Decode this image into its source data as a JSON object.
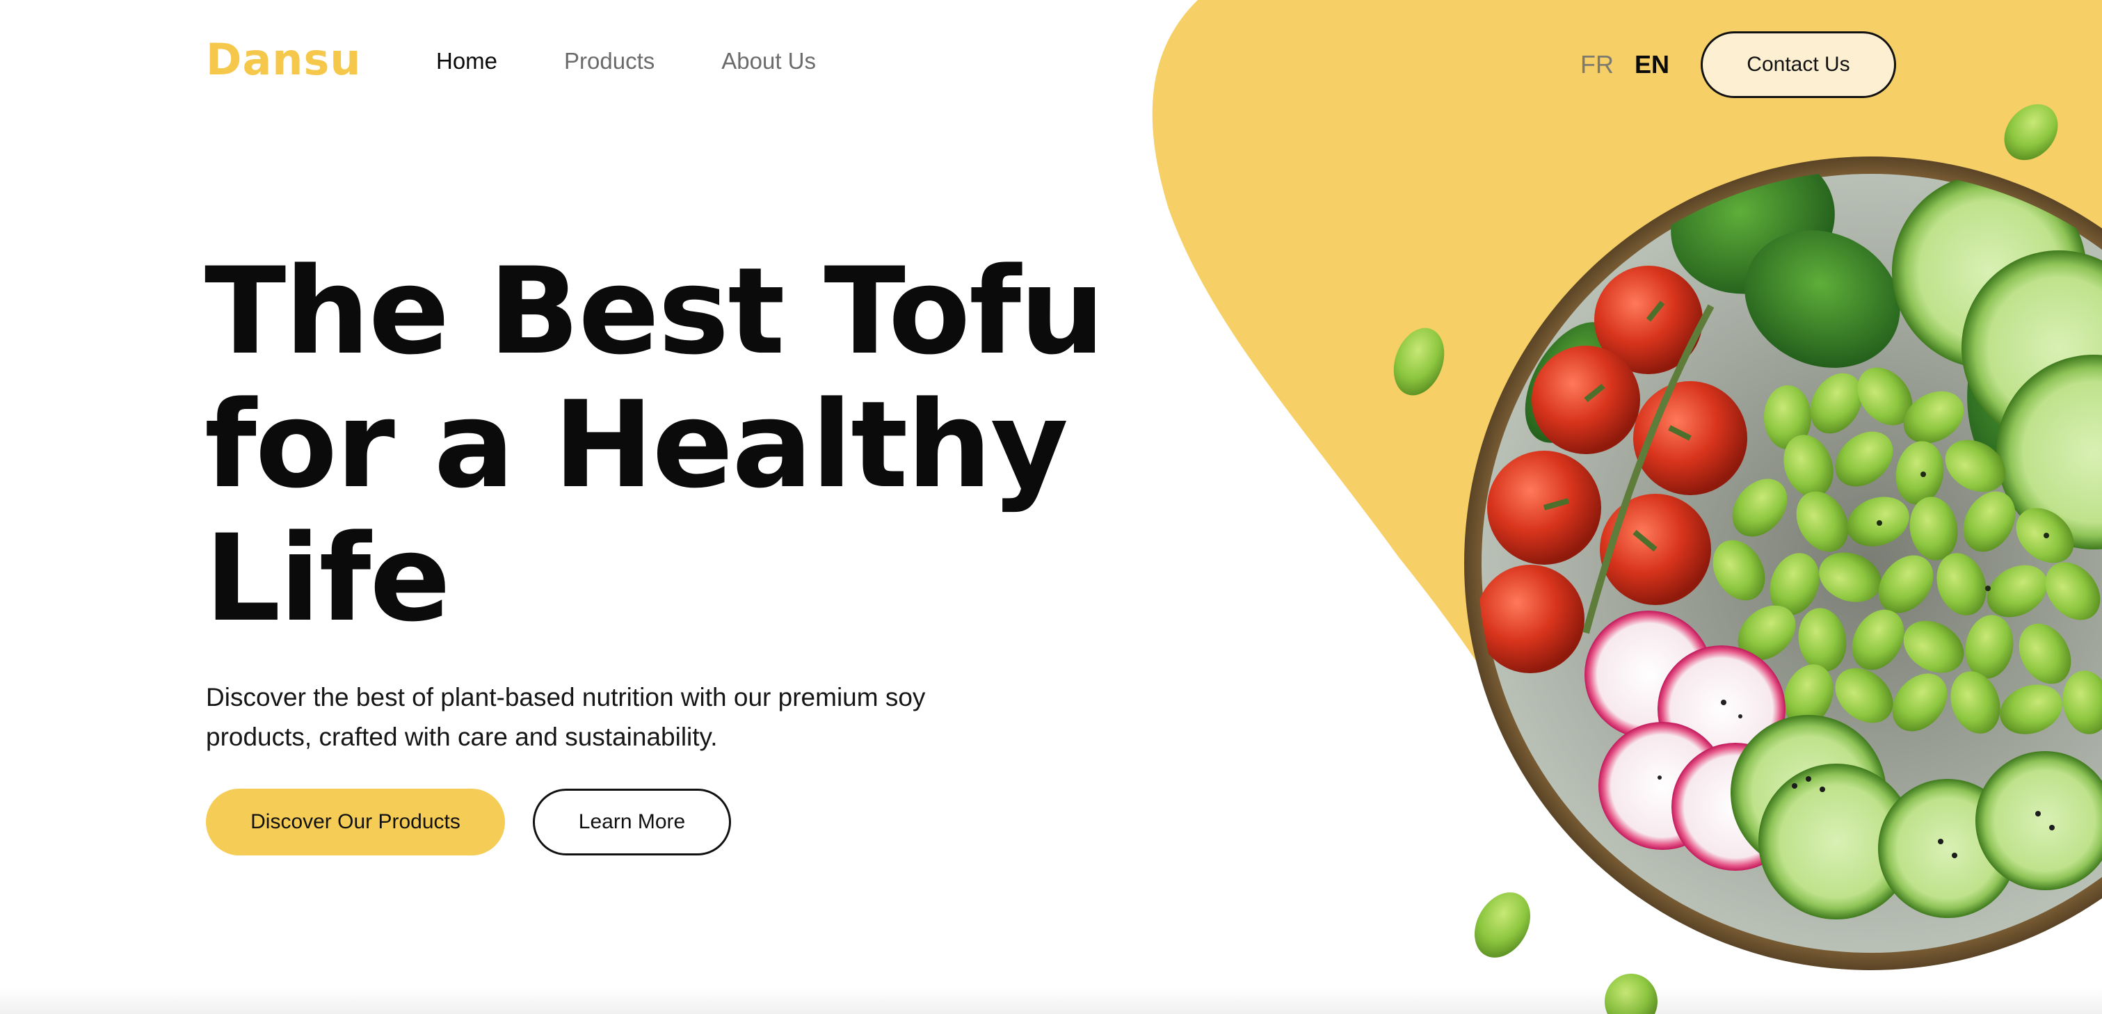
{
  "brand": {
    "name": "Dansu",
    "color": "#f5c84c"
  },
  "nav": {
    "items": [
      {
        "label": "Home",
        "active": true
      },
      {
        "label": "Products",
        "active": false
      },
      {
        "label": "About Us",
        "active": false
      }
    ]
  },
  "language": {
    "options": [
      "FR",
      "EN"
    ],
    "selected": "EN"
  },
  "header": {
    "contact_label": "Contact Us"
  },
  "hero": {
    "title": "The Best Tofu for a Healthy Life",
    "description": "Discover the best of plant-based nutrition with our premium soy products, crafted with care and sustainability.",
    "primary_cta": "Discover Our Products",
    "secondary_cta": "Learn More"
  },
  "colors": {
    "accent": "#f5cc55",
    "blob": "#f6d066",
    "contact_bg": "#fdf0d2",
    "text": "#0b0b0b",
    "nav_inactive": "#6b6b6b"
  },
  "illustration": {
    "subject": "salad bowl with cherry tomatoes, edamame, cucumber, radish and spinach"
  }
}
